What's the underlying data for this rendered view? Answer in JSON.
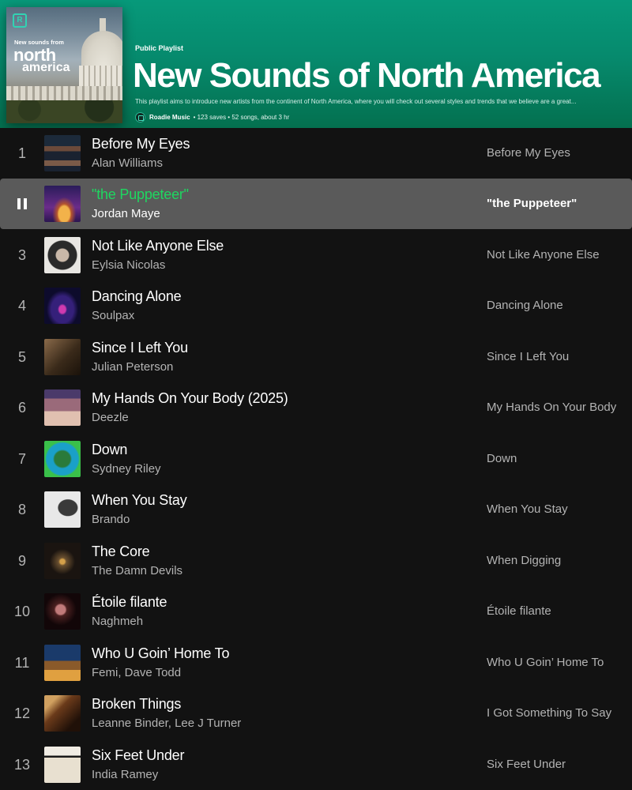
{
  "playlist": {
    "type_label": "Public Playlist",
    "title": "New Sounds of North America",
    "description": "This playlist aims to introduce new artists from the continent of North America, where you will check out several styles and trends that we believe are a great...",
    "owner": "Roadie Music",
    "stats": "• 123 saves • 52 songs, about 3 hr",
    "cover": {
      "small_text": "New sounds from",
      "big_line1": "north",
      "big_line2": "america"
    }
  },
  "tracks": [
    {
      "num": "1",
      "title": "Before My Eyes",
      "artist": "Alan Williams",
      "album": "Before My Eyes",
      "art": "a1"
    },
    {
      "num": "2",
      "title": "\"the Puppeteer\"",
      "artist": "Jordan Maye",
      "album": "\"the Puppeteer\"",
      "art": "a2",
      "playing": true
    },
    {
      "num": "3",
      "title": "Not Like Anyone Else",
      "artist": "Eylsia Nicolas",
      "album": "Not Like Anyone Else",
      "art": "a3"
    },
    {
      "num": "4",
      "title": "Dancing Alone",
      "artist": "Soulpax",
      "album": "Dancing Alone",
      "art": "a4"
    },
    {
      "num": "5",
      "title": "Since I Left You",
      "artist": "Julian Peterson",
      "album": "Since I Left You",
      "art": "a5"
    },
    {
      "num": "6",
      "title": "My Hands On Your Body (2025)",
      "artist": "Deezle",
      "album": "My Hands On Your Body",
      "art": "a6"
    },
    {
      "num": "7",
      "title": "Down",
      "artist": "Sydney Riley",
      "album": "Down",
      "art": "a7"
    },
    {
      "num": "8",
      "title": "When You Stay",
      "artist": "Brando",
      "album": "When You Stay",
      "art": "a8"
    },
    {
      "num": "9",
      "title": "The Core",
      "artist": "The Damn Devils",
      "album": "When Digging",
      "art": "a9"
    },
    {
      "num": "10",
      "title": "Étoile filante",
      "artist": "Naghmeh",
      "album": "Étoile filante",
      "art": "a10"
    },
    {
      "num": "11",
      "title": "Who U Goin’ Home To",
      "artist": "Femi, Dave Todd",
      "album": "Who U Goin’ Home To",
      "art": "a11"
    },
    {
      "num": "12",
      "title": "Broken Things",
      "artist": "Leanne Binder, Lee J Turner",
      "album": "I Got Something To Say",
      "art": "a12"
    },
    {
      "num": "13",
      "title": "Six Feet Under",
      "artist": "India Ramey",
      "album": "Six Feet Under",
      "art": "a13"
    }
  ],
  "colors": {
    "header_accent": "#07997a",
    "playing_title": "#1ed760",
    "background": "#121212",
    "active_row": "#5a5a5a"
  },
  "icons": {
    "now_playing": "pause-icon",
    "brand": "roadie-logo-icon"
  }
}
